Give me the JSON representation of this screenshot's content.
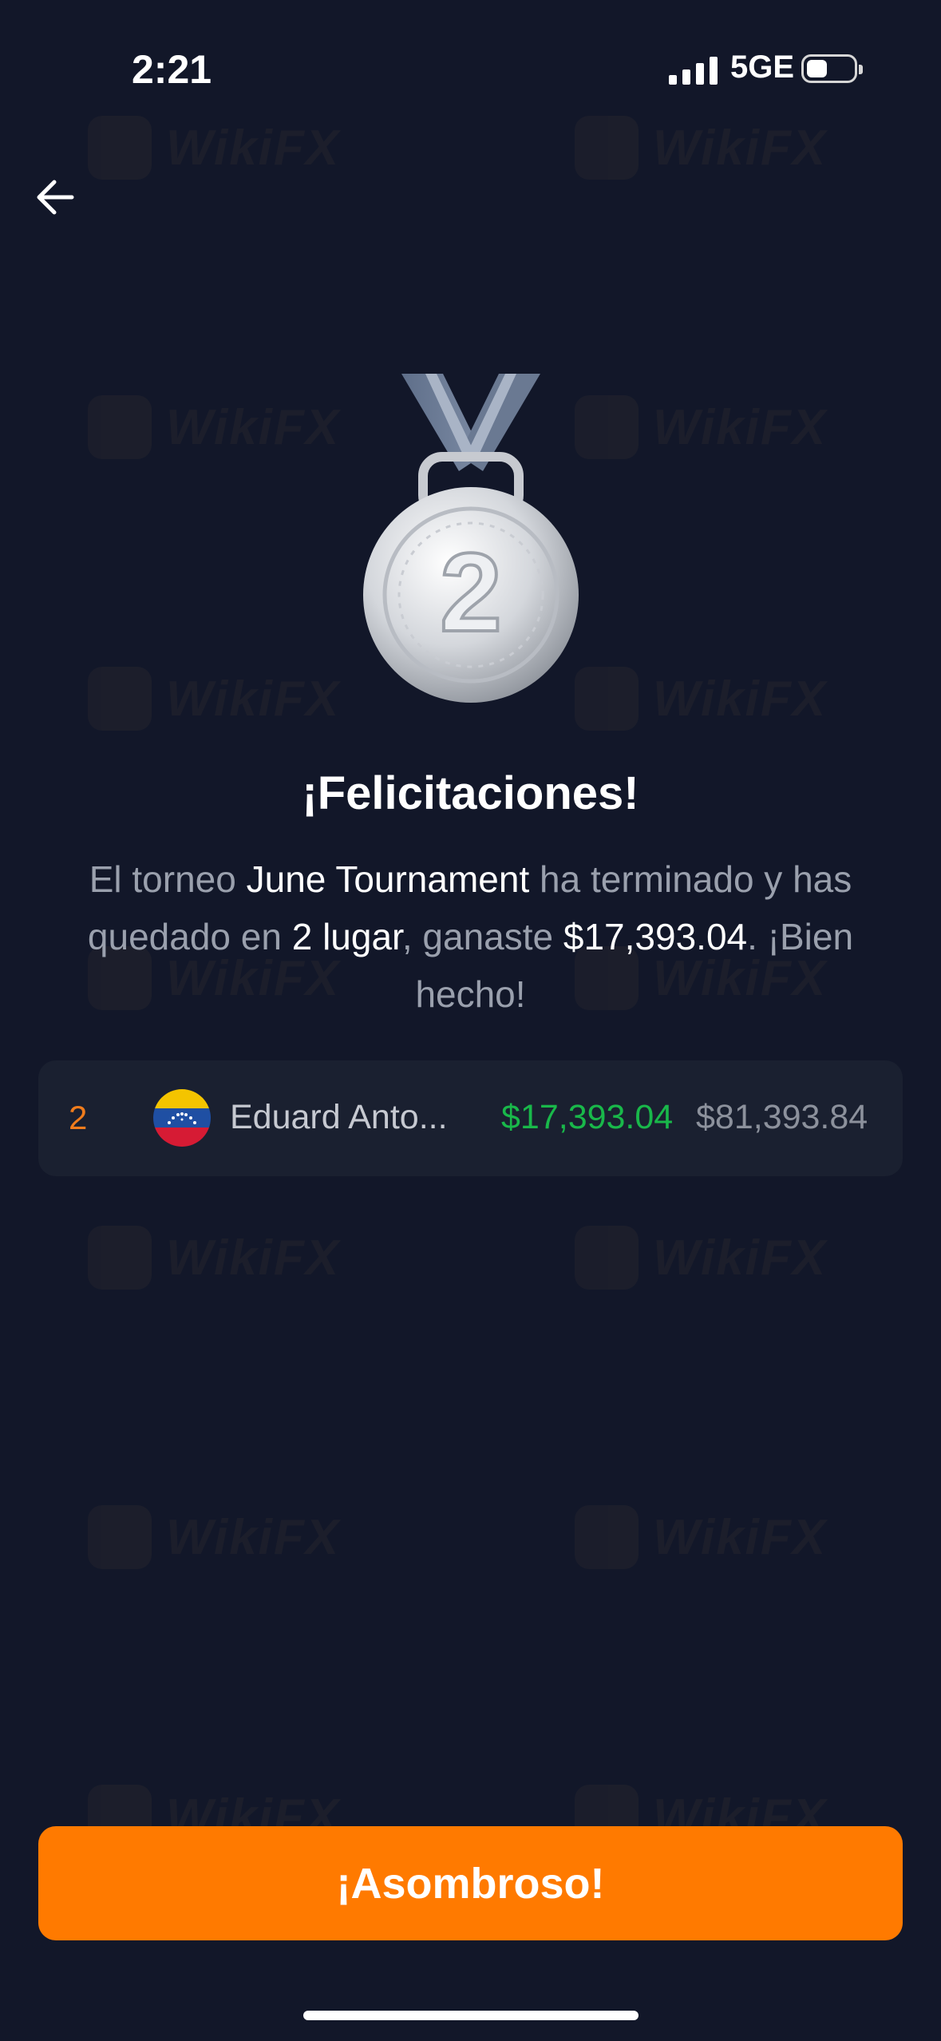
{
  "status_bar": {
    "time": "2:21",
    "network": "5GE",
    "battery_level": 0.4
  },
  "watermark": {
    "text": "WikiFX"
  },
  "medal": {
    "number": "2"
  },
  "title": "¡Felicitaciones!",
  "message": {
    "part1": "El torneo ",
    "tournament_name": "June Tournament",
    "part2": " ha terminado y has quedado en ",
    "position_text": "2 lugar",
    "part3": ", ganaste ",
    "prize_text": "$17,393.04",
    "part4": ". ¡Bien hecho!"
  },
  "result": {
    "rank": "2",
    "country_flag": "venezuela-flag",
    "player_name": "Eduard Anto...",
    "prize": "$17,393.04",
    "balance": "$81,393.84"
  },
  "cta": {
    "label": "¡Asombroso!"
  },
  "colors": {
    "background": "#121729",
    "row_background": "#1a2030",
    "accent": "#ff7a00",
    "rank": "#f07c1c",
    "prize": "#19b84a",
    "muted_text": "#9aa0ad"
  }
}
